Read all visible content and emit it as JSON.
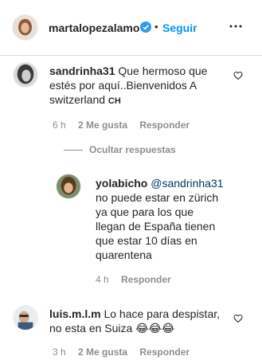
{
  "header": {
    "username": "martalopezalamo",
    "separator": "•",
    "follow_label": "Seguir"
  },
  "comments": [
    {
      "username": "sandrinha31",
      "text": "Que hermoso que estés por aquí..Bienvenidos A switzerland 🇨🇭",
      "line1": "Que hermoso que",
      "line2": "estés por aquí..Bienvenidos A",
      "line3": "switzerland",
      "flag": "CH",
      "time": "6 h",
      "likes": "2 Me gusta",
      "reply_label": "Responder"
    },
    {
      "username": "luis.m.l.m",
      "line1": "Lo hace para despistar,",
      "line2": "no esta en Suiza",
      "emoji": "😂😂😂",
      "time": "3 h",
      "likes": "2 Me gusta",
      "reply_label": "Responder"
    }
  ],
  "hide_replies_label": "Ocultar respuestas",
  "reply": {
    "username": "yolabicho",
    "mention": "@sandrinha31",
    "line2": "no puede estar en zürich",
    "line3": "ya que para los que",
    "line4": "llegan de España tienen",
    "line5": "que estar 10 días en",
    "line6": "quarentena",
    "time": "4 h",
    "reply_label": "Responder"
  },
  "colors": {
    "accent_blue": "#0095f6",
    "mention": "#00376b",
    "secondary_text": "#8e8e8e",
    "primary_text": "#262626"
  },
  "icons": [
    "verified-badge-icon",
    "more-options-icon",
    "heart-icon"
  ]
}
